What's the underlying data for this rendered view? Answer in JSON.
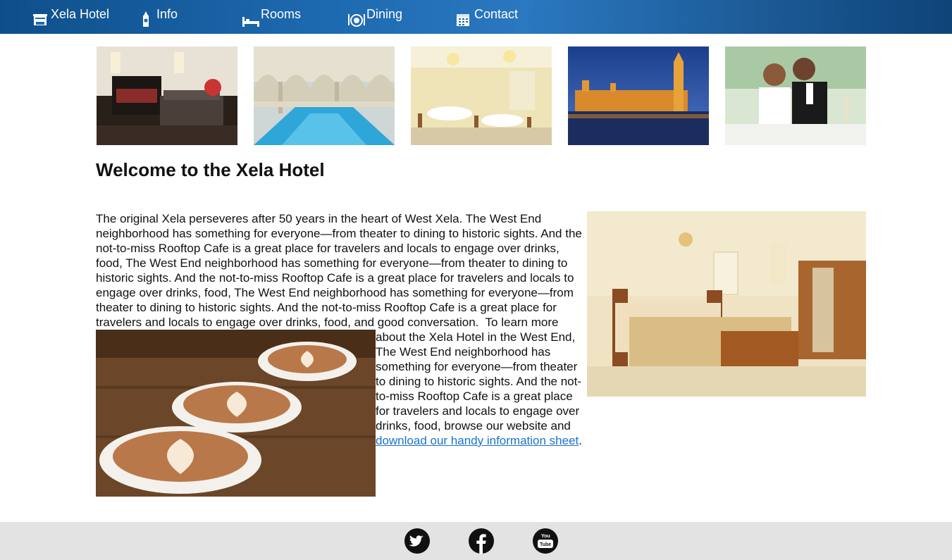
{
  "nav": {
    "items": [
      {
        "label": "Xela Hotel",
        "icon": "hotel-icon"
      },
      {
        "label": "Info",
        "icon": "big-ben-icon"
      },
      {
        "label": "Rooms",
        "icon": "bed-icon"
      },
      {
        "label": "Dining",
        "icon": "dining-plate-icon"
      },
      {
        "label": "Contact",
        "icon": "calendar-icon"
      }
    ]
  },
  "gallery": [
    {
      "alt": "Guest bedroom"
    },
    {
      "alt": "Indoor pool"
    },
    {
      "alt": "Banquet hall"
    },
    {
      "alt": "Houses of Parliament at dusk"
    },
    {
      "alt": "Wedding couple"
    }
  ],
  "main": {
    "title": "Welcome to the Xela Hotel",
    "body_text": "The original Xela perseveres after 50 years in the heart of West Xela. The West End neighborhood has something for everyone—from theater to dining to historic sights. And the not-to-miss Rooftop Cafe is a great place for travelers and locals to engage over drinks, food, The West End neighborhood has something for everyone—from theater to dining to historic sights. And the not-to-miss Rooftop Cafe is a great place for travelers and locals to engage over drinks, food, The West End neighborhood has something for everyone—from theater to dining to historic sights. And the not-to-miss Rooftop Cafe is a great place for travelers and locals to engage over drinks, food, and good conversation.  To learn more about the Xela Hotel in the West End, The West End neighborhood has something for everyone—from theater to dining to historic sights. And the not-to-miss Rooftop Cafe is a great place for travelers and locals to engage over drinks, food, browse our website and ",
    "link_text": "download our handy information sheet",
    "trailing": "."
  },
  "footer": {
    "social": [
      {
        "icon": "twitter-icon"
      },
      {
        "icon": "facebook-icon"
      },
      {
        "icon": "youtube-icon",
        "text": "You Tube"
      }
    ]
  },
  "colors": {
    "nav_bar": "#1e6ab1",
    "link": "#1a73c9",
    "footer": "#e3e3e3",
    "social_icon": "#111111"
  }
}
